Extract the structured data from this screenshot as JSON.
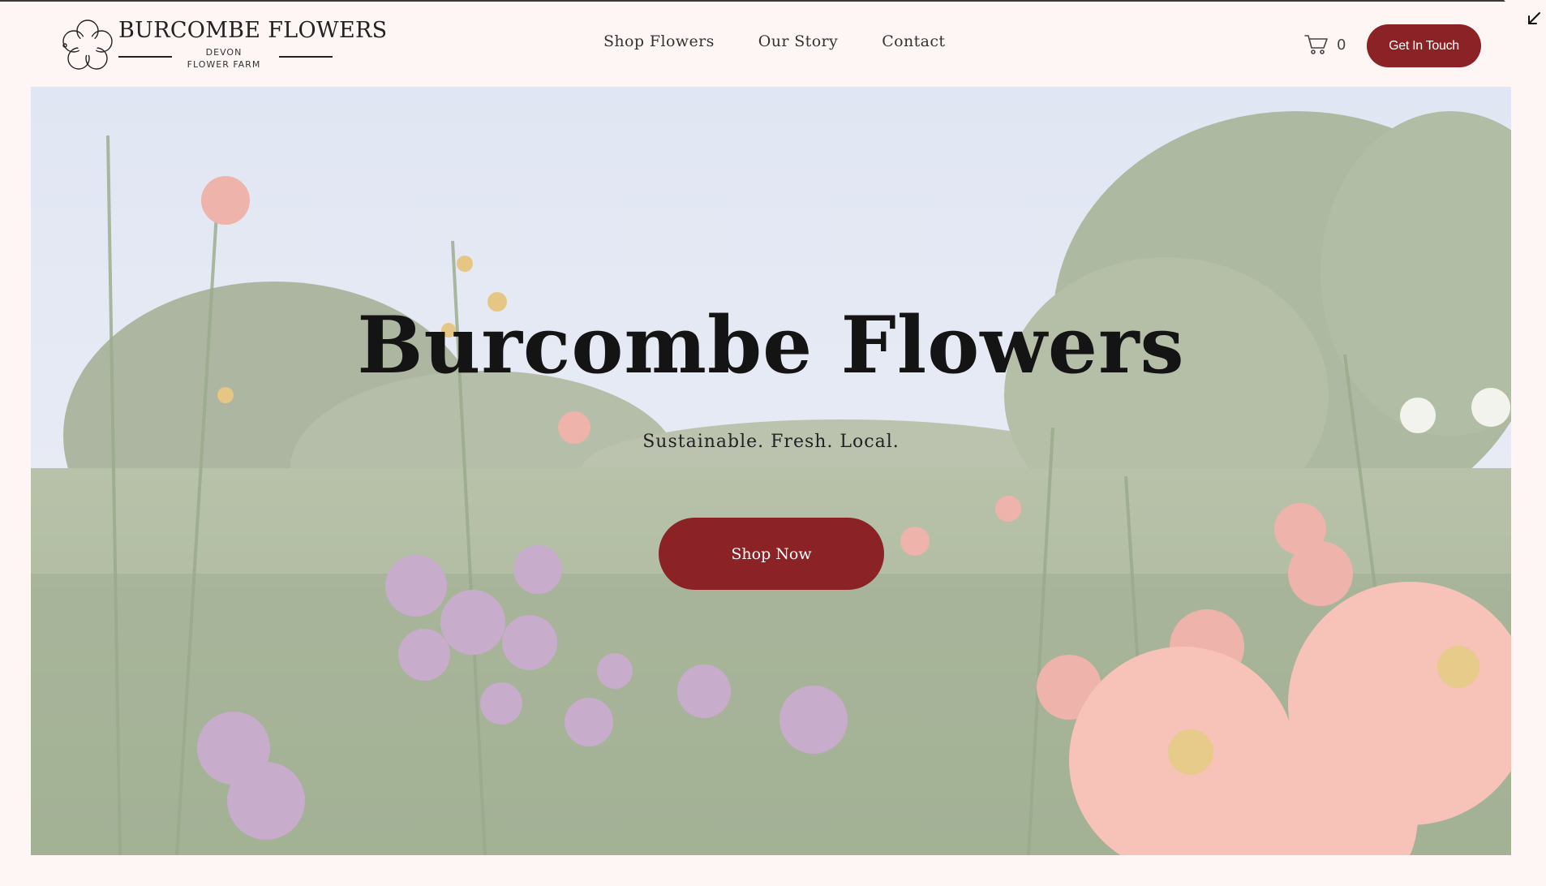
{
  "brand": {
    "name": "BURCOMBE FLOWERS",
    "sub_line_1": "DEVON",
    "sub_line_2": "FLOWER FARM"
  },
  "nav": {
    "items": [
      {
        "label": "Shop Flowers"
      },
      {
        "label": "Our Story"
      },
      {
        "label": "Contact"
      }
    ]
  },
  "cart": {
    "count": "0",
    "icon": "cart-icon"
  },
  "header": {
    "cta_label": "Get In Touch"
  },
  "hero": {
    "title": "Burcombe Flowers",
    "subtitle": "Sustainable. Fresh. Local.",
    "button_label": "Shop Now"
  },
  "colors": {
    "accent": "#8b2326",
    "background": "#fdf6f4",
    "text": "#141414"
  }
}
